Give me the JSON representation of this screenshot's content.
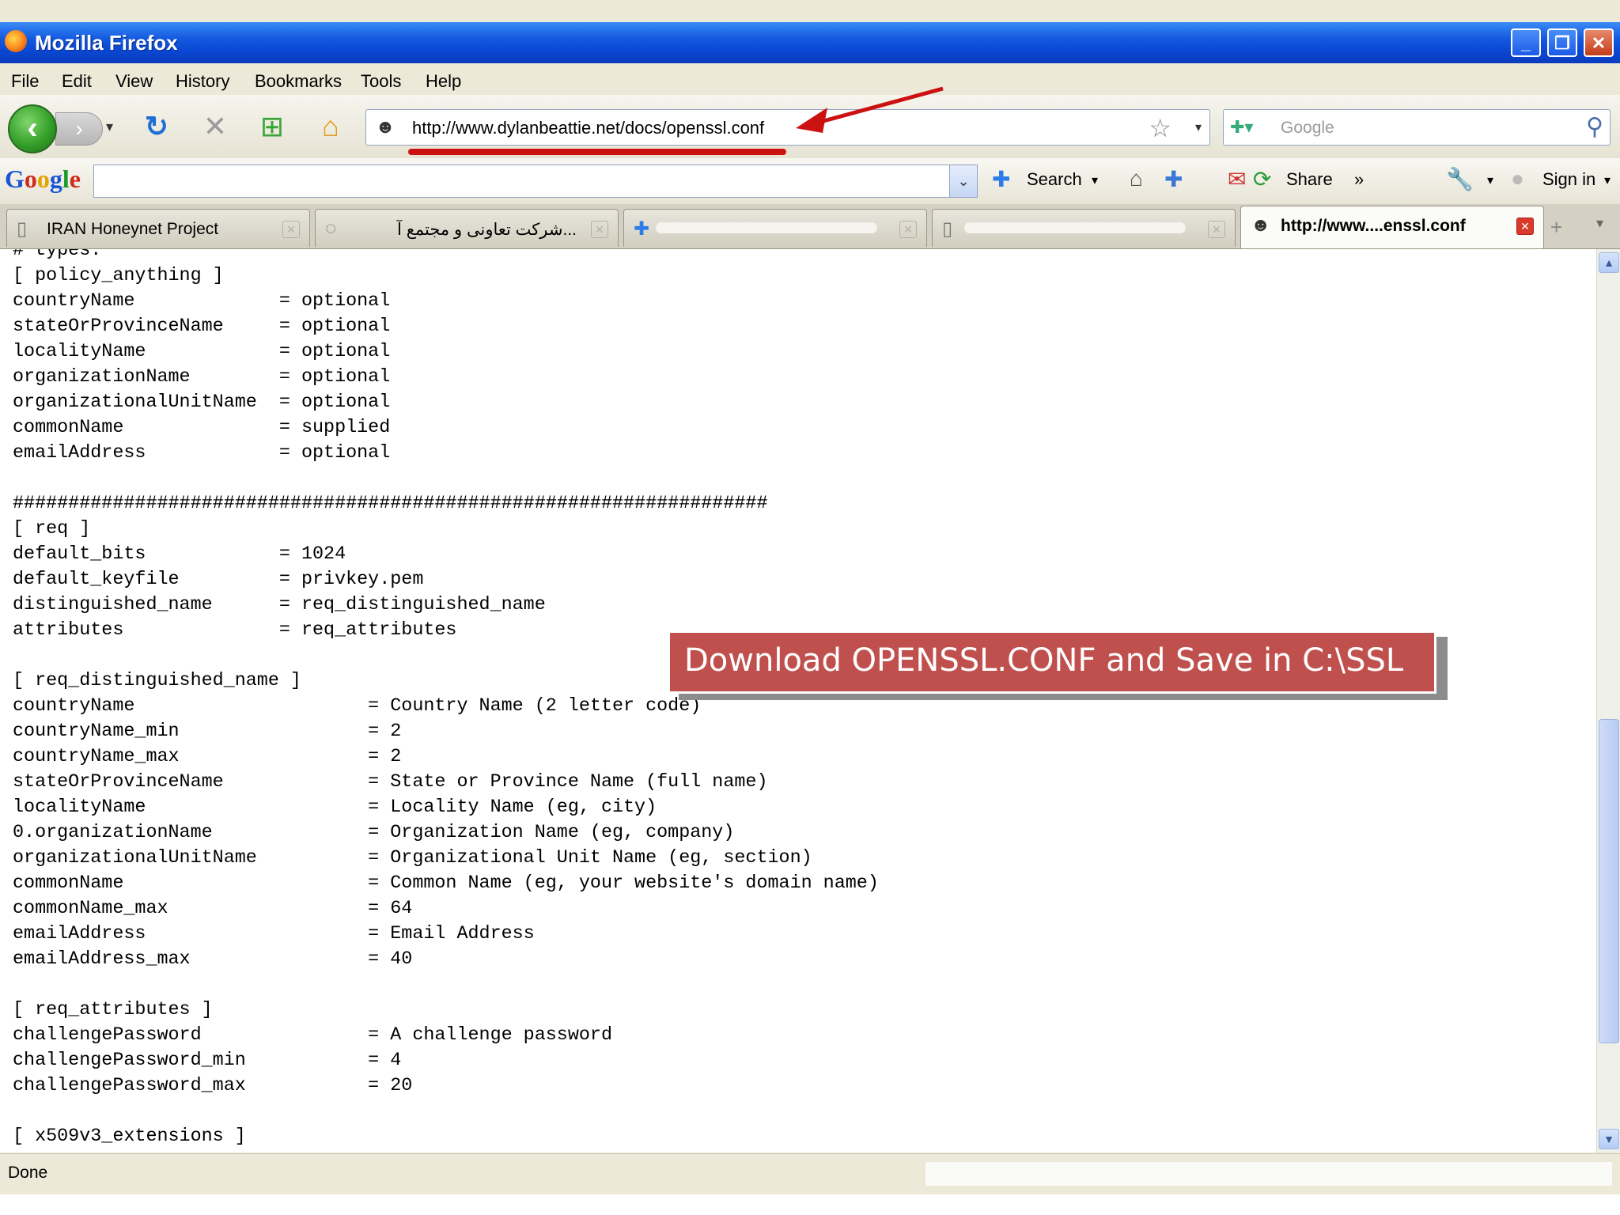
{
  "window": {
    "title": "Mozilla Firefox",
    "minimize": "_",
    "restore": "❐",
    "close": "✕"
  },
  "menu": [
    "File",
    "Edit",
    "View",
    "History",
    "Bookmarks",
    "Tools",
    "Help"
  ],
  "nav": {
    "url": "http://www.dylanbeattie.net/docs/openssl.conf",
    "search_placeholder": "Google"
  },
  "google_toolbar": {
    "logo": [
      "G",
      "o",
      "o",
      "g",
      "l",
      "e"
    ],
    "search_label": "Search",
    "share_label": "Share",
    "more": "»",
    "signin_label": "Sign in"
  },
  "tabs": [
    {
      "label": "IRAN Honeynet Project"
    },
    {
      "label": "...شرکت تعاونی و مجتمع آ"
    },
    {
      "label": ""
    },
    {
      "label": ""
    },
    {
      "label": "http://www....enssl.conf"
    }
  ],
  "content": {
    "lines": [
      "# types.",
      "[ policy_anything ]",
      "countryName             = optional",
      "stateOrProvinceName     = optional",
      "localityName            = optional",
      "organizationName        = optional",
      "organizationalUnitName  = optional",
      "commonName              = supplied",
      "emailAddress            = optional",
      "",
      "####################################################################",
      "[ req ]",
      "default_bits            = 1024",
      "default_keyfile         = privkey.pem",
      "distinguished_name      = req_distinguished_name",
      "attributes              = req_attributes",
      "",
      "[ req_distinguished_name ]",
      "countryName                     = Country Name (2 letter code)",
      "countryName_min                 = 2",
      "countryName_max                 = 2",
      "stateOrProvinceName             = State or Province Name (full name)",
      "localityName                    = Locality Name (eg, city)",
      "0.organizationName              = Organization Name (eg, company)",
      "organizationalUnitName          = Organizational Unit Name (eg, section)",
      "commonName                      = Common Name (eg, your website's domain name)",
      "commonName_max                  = 64",
      "emailAddress                    = Email Address",
      "emailAddress_max                = 40",
      "",
      "[ req_attributes ]",
      "challengePassword               = A challenge password",
      "challengePassword_min           = 4",
      "challengePassword_max           = 20",
      "",
      "[ x509v3_extensions ]"
    ],
    "annotation": "Download OPENSSL.CONF and Save in C:\\SSL"
  },
  "status": {
    "text": "Done"
  },
  "colors": {
    "title_bar": "#0a47d2",
    "annotation_bg": "#c0504d",
    "arrow": "#cc1111"
  },
  "icons": [
    "firefox-icon",
    "back-icon",
    "forward-icon",
    "reload-icon",
    "stop-icon",
    "new-tab-icon",
    "home-icon",
    "site-identity-icon",
    "bookmark-star-icon",
    "search-engine-icon",
    "magnifier-icon",
    "wrench-icon",
    "page-icon",
    "google-icon"
  ]
}
